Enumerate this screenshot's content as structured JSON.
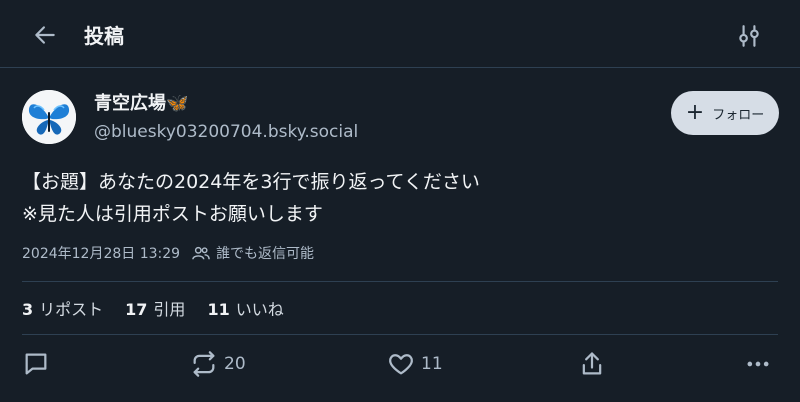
{
  "header": {
    "title": "投稿"
  },
  "author": {
    "display_name": "青空広場🦋",
    "handle": "@bluesky03200704.bsky.social"
  },
  "follow_button": {
    "label": "フォロー"
  },
  "post": {
    "lines": [
      "【お題】あなたの2024年を3行で振り返ってください",
      "※見た人は引用ポストお願いします"
    ],
    "timestamp": "2024年12月28日 13:29",
    "reply_permission": "誰でも返信可能"
  },
  "stats": {
    "reposts": {
      "count": "3",
      "label": "リポスト"
    },
    "quotes": {
      "count": "17",
      "label": "引用"
    },
    "likes": {
      "count": "11",
      "label": "いいね"
    }
  },
  "actions": {
    "repost_count": "20",
    "like_count": "11"
  },
  "icons": {
    "back": "arrow-left-icon",
    "filter": "filter-sliders-icon",
    "people": "people-icon",
    "reply": "reply-bubble-icon",
    "repost": "repost-icon",
    "like": "heart-icon",
    "share": "share-icon",
    "more": "more-dots-icon"
  },
  "colors": {
    "background": "#161e27",
    "divider": "#2e4052",
    "muted_text": "#aebbc9",
    "follow_button_bg": "#d6dde6"
  }
}
